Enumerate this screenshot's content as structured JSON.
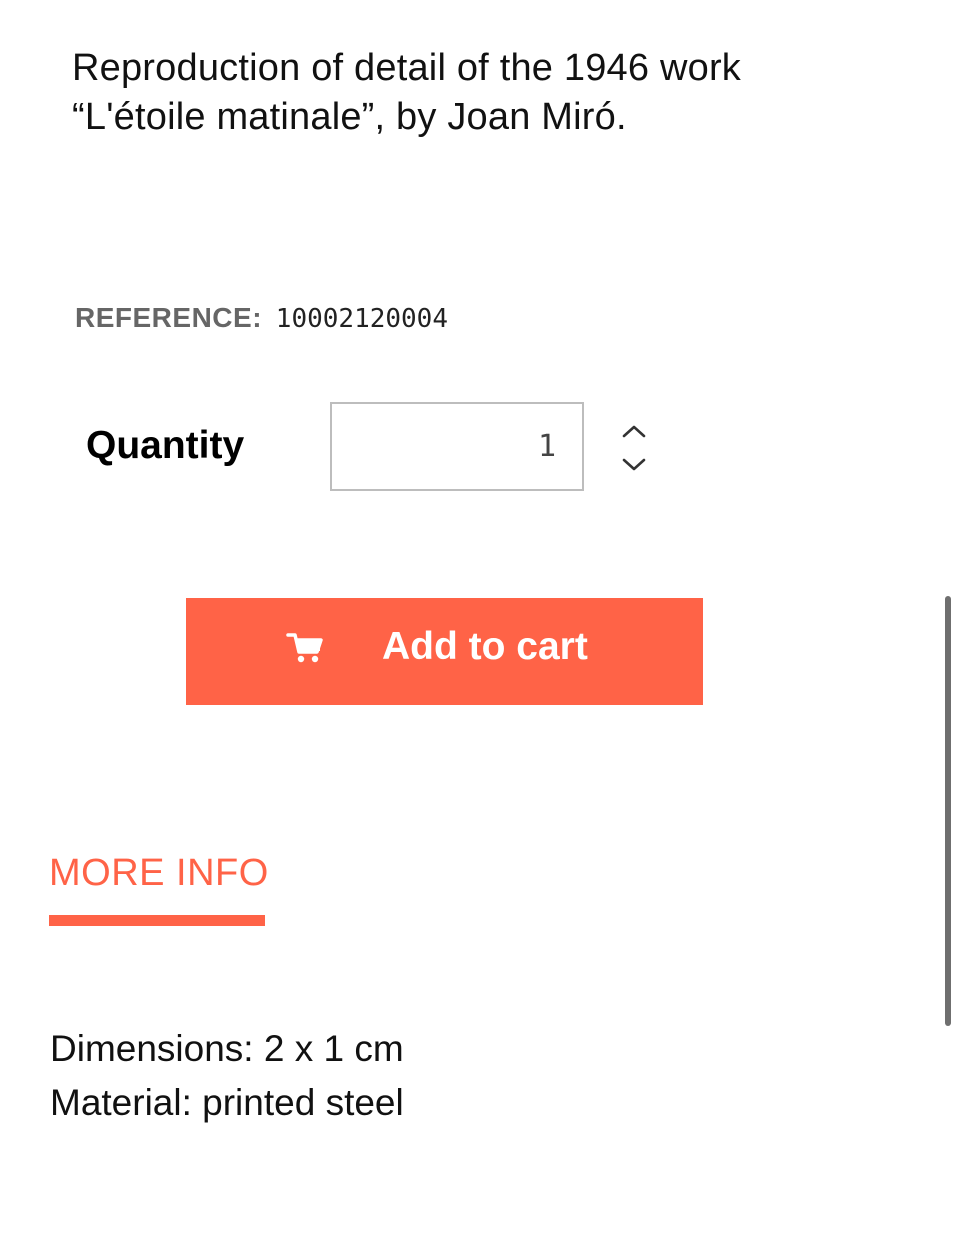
{
  "product": {
    "description_line1": "Reproduction of detail of the 1946 work",
    "description_line2": "“L'étoile matinale”, by Joan Miró.",
    "reference_label": "REFERENCE:",
    "reference_value": "10002120004"
  },
  "quantity": {
    "label": "Quantity",
    "value": "1",
    "increase_icon": "chevron-up-icon",
    "decrease_icon": "chevron-down-icon"
  },
  "cart_button": {
    "icon": "shopping-cart-icon",
    "label": "Add to cart",
    "color": "#ff6347"
  },
  "tabs": [
    {
      "label": "MORE INFO",
      "active": true
    }
  ],
  "details": {
    "dimensions": "Dimensions: 2 x 1 cm",
    "material": "Material: printed steel"
  },
  "colors": {
    "accent": "#ff6347",
    "reference_label": "#666666"
  }
}
